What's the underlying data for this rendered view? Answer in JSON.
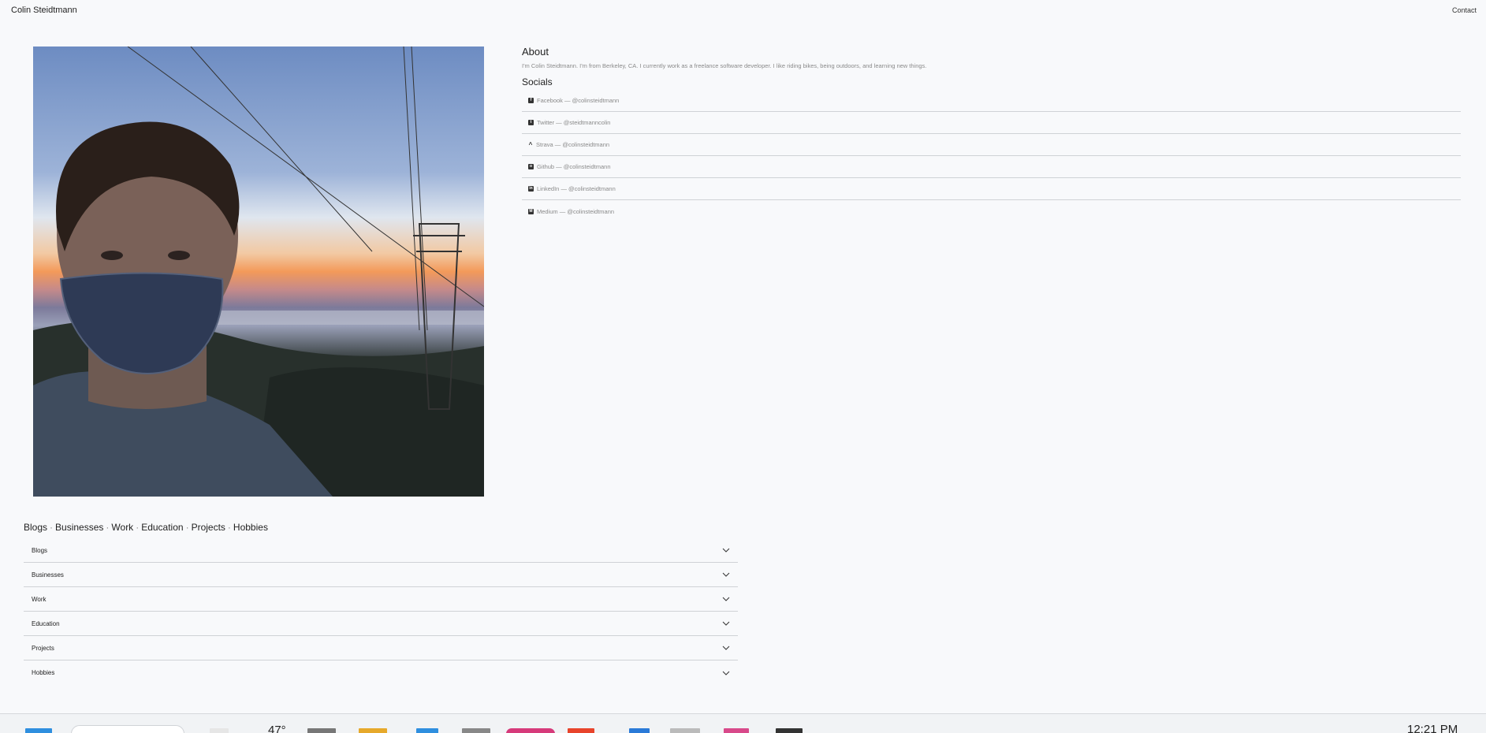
{
  "header": {
    "site_name": "Colin Steidtmann",
    "contact_label": "Contact"
  },
  "about": {
    "heading": "About",
    "text": "I'm Colin Steidtmann. I'm from Berkeley, CA. I currently work as a freelance software developer. I like riding bikes, being outdoors, and learning new things."
  },
  "socials": {
    "heading": "Socials",
    "items": [
      {
        "label": "Facebook — @colinsteidtmann",
        "icon": "facebook-icon"
      },
      {
        "label": "Twitter — @steidtmanncolin",
        "icon": "twitter-icon"
      },
      {
        "label": "Strava — @colinsteidtmann",
        "icon": "strava-icon"
      },
      {
        "label": "Github — @colinsteidtmann",
        "icon": "github-icon"
      },
      {
        "label": "LinkedIn — @colinsteidtmann",
        "icon": "linkedin-icon"
      },
      {
        "label": "Medium — @colinsteidtmann",
        "icon": "medium-icon"
      }
    ]
  },
  "section_nav": {
    "links": [
      "Blogs",
      "Businesses",
      "Work",
      "Education",
      "Projects",
      "Hobbies"
    ],
    "separator": "·"
  },
  "accordion": {
    "items": [
      "Blogs",
      "Businesses",
      "Work",
      "Education",
      "Projects",
      "Hobbies"
    ]
  },
  "taskbar": {
    "temperature": "47°",
    "time": "12:21 PM"
  }
}
